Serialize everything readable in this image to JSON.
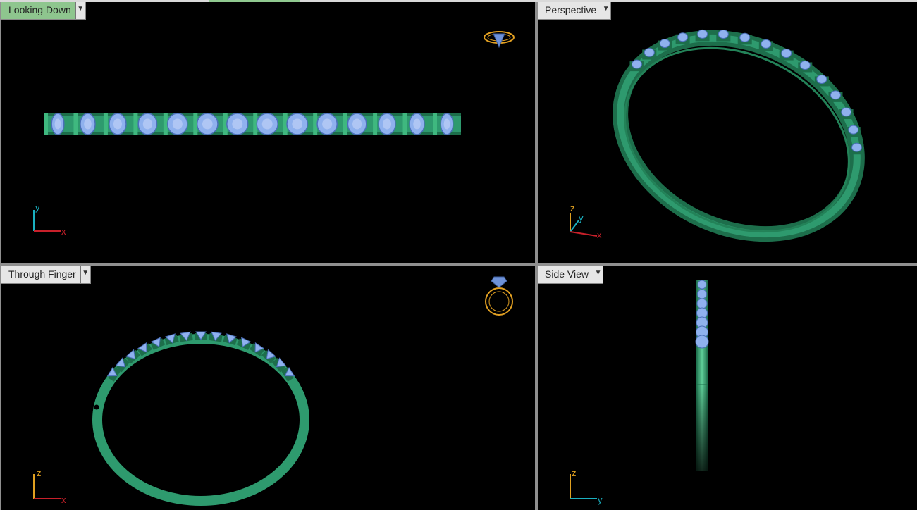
{
  "viewports": {
    "top_left": {
      "label": "Looking Down",
      "active": true,
      "axes": [
        "y",
        "x"
      ]
    },
    "top_right": {
      "label": "Perspective",
      "active": false,
      "axes": [
        "z",
        "y",
        "x"
      ]
    },
    "bottom_left": {
      "label": "Through Finger",
      "active": false,
      "axes": [
        "z",
        "x"
      ]
    },
    "bottom_right": {
      "label": "Side View",
      "active": false,
      "axes": [
        "z",
        "y"
      ]
    }
  },
  "icons": {
    "dropdown": "chevron-down-icon",
    "nav_cube": "ring-preview-icon"
  },
  "colors": {
    "viewport_bg": "#000000",
    "metal": "#2e9a6e",
    "metal_dark": "#1d6e4b",
    "gem": "#8fb1ee",
    "axis_x": "#c8202a",
    "axis_y": "#1ab0c0",
    "axis_z": "#e0a020",
    "active_label": "#8ec68e"
  }
}
